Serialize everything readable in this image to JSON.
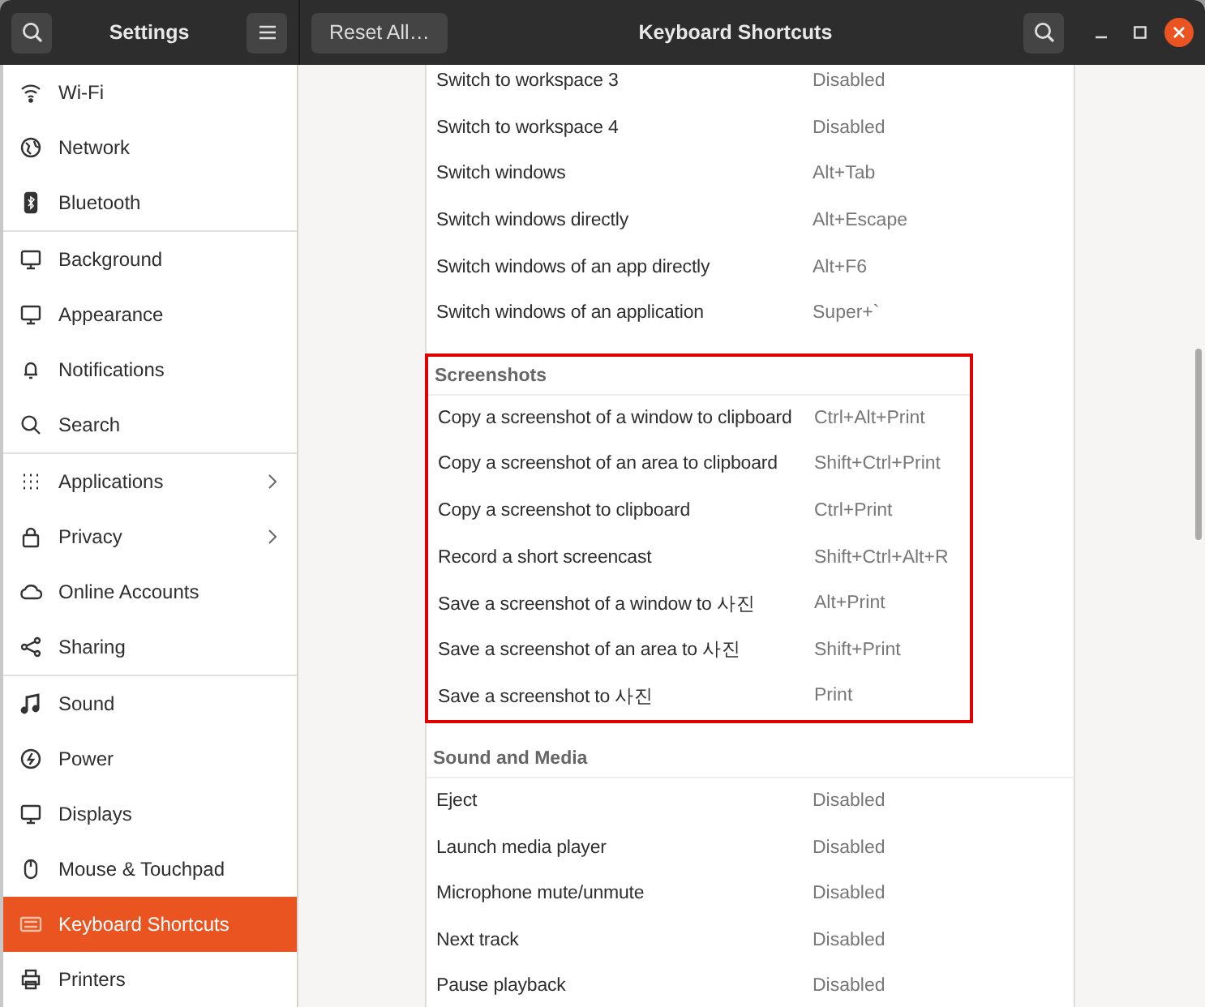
{
  "header": {
    "sidebar_title": "Settings",
    "reset_button": "Reset All…",
    "title": "Keyboard Shortcuts"
  },
  "sidebar": {
    "groups": [
      {
        "items": [
          {
            "label": "Wi-Fi",
            "selected": false,
            "has_arrow": false
          },
          {
            "label": "Network",
            "selected": false,
            "has_arrow": false
          },
          {
            "label": "Bluetooth",
            "selected": false,
            "has_arrow": false
          }
        ]
      },
      {
        "items": [
          {
            "label": "Background",
            "selected": false,
            "has_arrow": false
          },
          {
            "label": "Appearance",
            "selected": false,
            "has_arrow": false
          },
          {
            "label": "Notifications",
            "selected": false,
            "has_arrow": false
          },
          {
            "label": "Search",
            "selected": false,
            "has_arrow": false
          }
        ]
      },
      {
        "items": [
          {
            "label": "Applications",
            "selected": false,
            "has_arrow": true
          },
          {
            "label": "Privacy",
            "selected": false,
            "has_arrow": true
          },
          {
            "label": "Online Accounts",
            "selected": false,
            "has_arrow": false
          },
          {
            "label": "Sharing",
            "selected": false,
            "has_arrow": false
          }
        ]
      },
      {
        "items": [
          {
            "label": "Sound",
            "selected": false,
            "has_arrow": false
          },
          {
            "label": "Power",
            "selected": false,
            "has_arrow": false
          },
          {
            "label": "Displays",
            "selected": false,
            "has_arrow": false
          },
          {
            "label": "Mouse & Touchpad",
            "selected": false,
            "has_arrow": false
          },
          {
            "label": "Keyboard Shortcuts",
            "selected": true,
            "has_arrow": false
          },
          {
            "label": "Printers",
            "selected": false,
            "has_arrow": false
          }
        ]
      }
    ]
  },
  "sections": [
    {
      "highlighted": false,
      "rows": [
        {
          "action": "Switch to workspace 3",
          "shortcut": "Disabled"
        },
        {
          "action": "Switch to workspace 4",
          "shortcut": "Disabled"
        },
        {
          "action": "Switch windows",
          "shortcut": "Alt+Tab"
        },
        {
          "action": "Switch windows directly",
          "shortcut": "Alt+Escape"
        },
        {
          "action": "Switch windows of an app directly",
          "shortcut": "Alt+F6"
        },
        {
          "action": "Switch windows of an application",
          "shortcut": "Super+`"
        }
      ]
    },
    {
      "title": "Screenshots",
      "highlighted": true,
      "rows": [
        {
          "action": "Copy a screenshot of a window to clipboard",
          "shortcut": "Ctrl+Alt+Print"
        },
        {
          "action": "Copy a screenshot of an area to clipboard",
          "shortcut": "Shift+Ctrl+Print"
        },
        {
          "action": "Copy a screenshot to clipboard",
          "shortcut": "Ctrl+Print"
        },
        {
          "action": "Record a short screencast",
          "shortcut": "Shift+Ctrl+Alt+R"
        },
        {
          "action": "Save a screenshot of a window to 사진",
          "shortcut": "Alt+Print"
        },
        {
          "action": "Save a screenshot of an area to 사진",
          "shortcut": "Shift+Print"
        },
        {
          "action": "Save a screenshot to 사진",
          "shortcut": "Print"
        }
      ]
    },
    {
      "title": "Sound and Media",
      "highlighted": false,
      "rows": [
        {
          "action": "Eject",
          "shortcut": "Disabled"
        },
        {
          "action": "Launch media player",
          "shortcut": "Disabled"
        },
        {
          "action": "Microphone mute/unmute",
          "shortcut": "Disabled"
        },
        {
          "action": "Next track",
          "shortcut": "Disabled"
        },
        {
          "action": "Pause playback",
          "shortcut": "Disabled"
        }
      ]
    }
  ]
}
